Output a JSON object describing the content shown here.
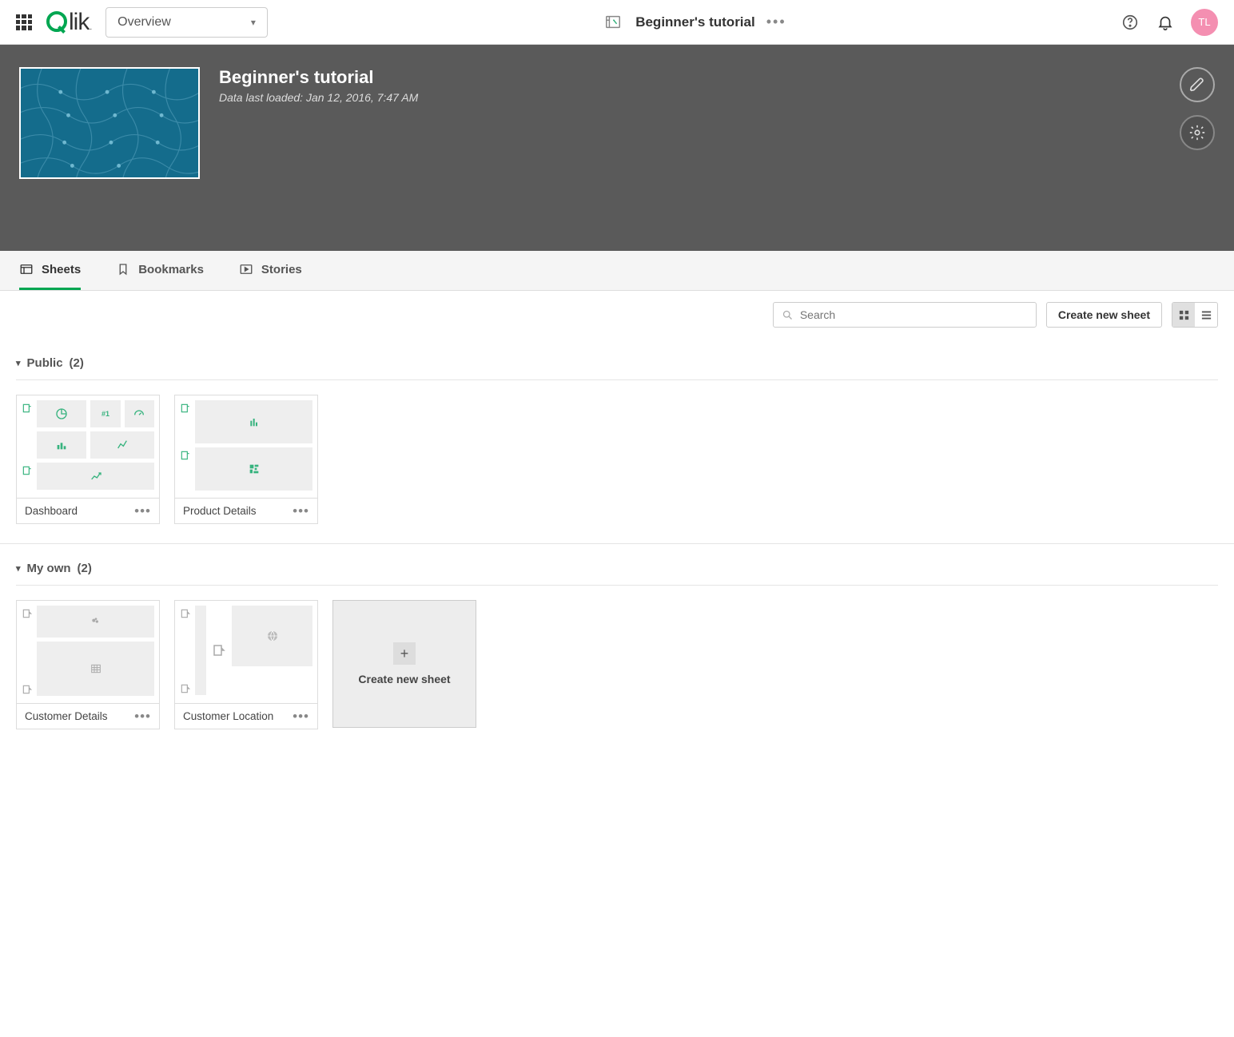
{
  "topbar": {
    "logo_text": "lik",
    "dropdown_label": "Overview",
    "app_title": "Beginner's tutorial",
    "avatar_initials": "TL"
  },
  "hero": {
    "title": "Beginner's tutorial",
    "subtitle": "Data last loaded: Jan 12, 2016, 7:47 AM"
  },
  "tabs": {
    "sheets": "Sheets",
    "bookmarks": "Bookmarks",
    "stories": "Stories"
  },
  "toolbar": {
    "search_placeholder": "Search",
    "create_label": "Create new sheet"
  },
  "sections": {
    "public": {
      "label": "Public",
      "count": "(2)",
      "items": [
        {
          "name": "Dashboard"
        },
        {
          "name": "Product Details"
        }
      ]
    },
    "myown": {
      "label": "My own",
      "count": "(2)",
      "items": [
        {
          "name": "Customer Details"
        },
        {
          "name": "Customer Location"
        }
      ],
      "create_label": "Create new sheet"
    }
  }
}
